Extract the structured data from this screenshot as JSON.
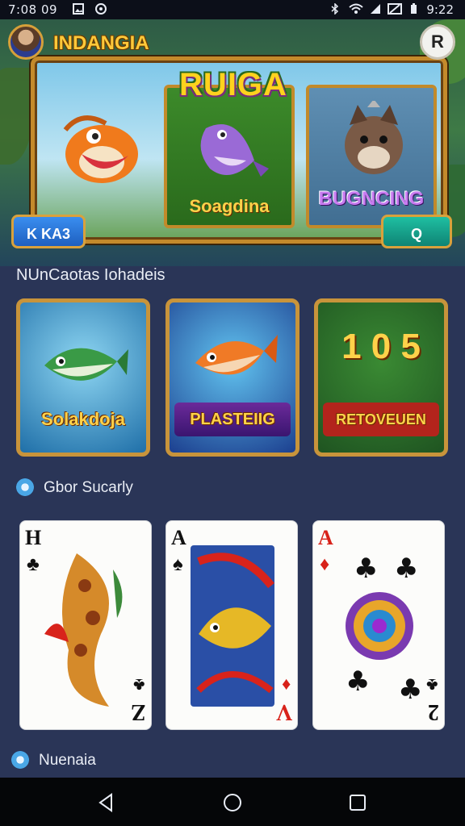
{
  "status_bar": {
    "time": "7:08 09",
    "clock": "9:22",
    "icons": [
      "image-icon",
      "chat-icon",
      "bluetooth-icon",
      "wifi-icon",
      "signal-icon",
      "no-signal-icon",
      "battery-icon"
    ]
  },
  "header": {
    "brand_name": "INDANGIA",
    "corner_button": "R"
  },
  "hero": {
    "title": "RUIGA",
    "center_label": "Soagdina",
    "right_label": "BUGNCING",
    "left_button": "K KA3",
    "right_button": "Q"
  },
  "section": {
    "title": "NUnCaotas Iohadeis",
    "tiles": [
      {
        "label": "Solakdoja",
        "icon": "fish-icon"
      },
      {
        "label": "PLASTEIIG",
        "icon": "fish-icon"
      },
      {
        "label": "RETOVEUEN",
        "icon": "slot-icon",
        "number": "1 0 5"
      }
    ]
  },
  "cards_section": {
    "title": "Gbor Sucarly",
    "cards": [
      {
        "rank": "H",
        "bottom_rank": "Z",
        "suit": "♣",
        "bottom_suit": "♣",
        "red": false
      },
      {
        "rank": "A",
        "bottom_rank": "V",
        "suit": "♠",
        "bottom_suit": "♦",
        "red": false
      },
      {
        "rank": "A",
        "bottom_rank": "2",
        "suit": "♦",
        "bottom_suit": "♣",
        "red": true
      }
    ]
  },
  "bottom": {
    "title": "Nuenaia"
  },
  "colors": {
    "background": "#2a3557",
    "gold": "#c8943b",
    "brand_text": "#ffc93a"
  }
}
